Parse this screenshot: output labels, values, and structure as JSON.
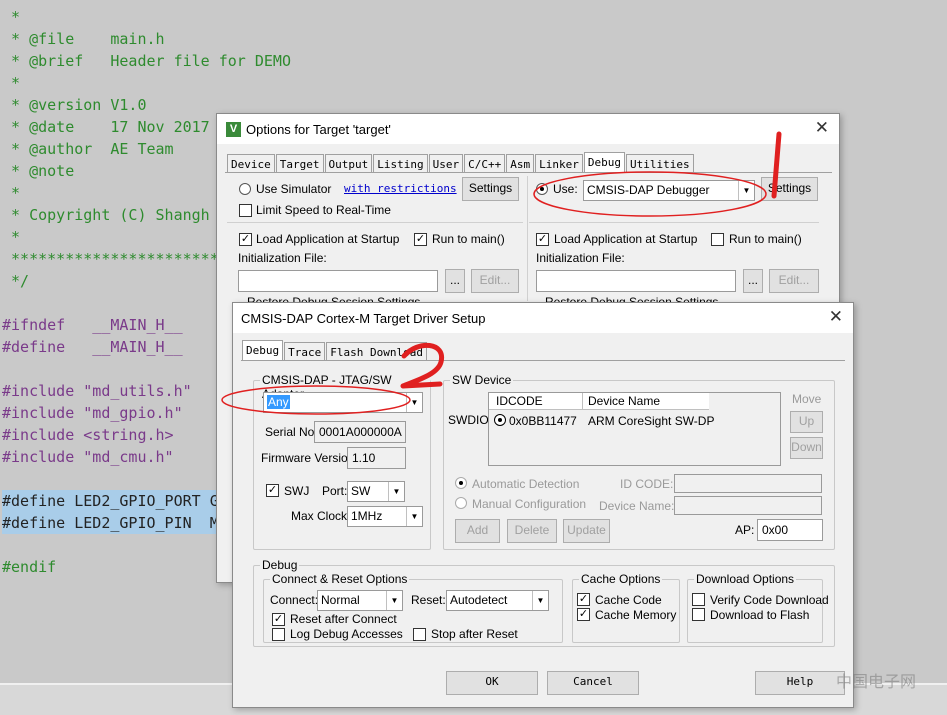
{
  "editor": {
    "lines": [
      {
        "text": " *",
        "color": "green",
        "hl": false
      },
      {
        "text": " * @file    main.h",
        "color": "green",
        "hl": false
      },
      {
        "text": " * @brief   Header file for DEMO",
        "color": "green",
        "hl": false
      },
      {
        "text": " *",
        "color": "green",
        "hl": false
      },
      {
        "text": " * @version V1.0",
        "color": "green",
        "hl": false
      },
      {
        "text": " * @date    17 Nov 2017",
        "color": "green",
        "hl": false
      },
      {
        "text": " * @author  AE Team",
        "color": "green",
        "hl": false
      },
      {
        "text": " * @note",
        "color": "green",
        "hl": false
      },
      {
        "text": " *",
        "color": "green",
        "hl": false
      },
      {
        "text": " * Copyright (C) Shangh",
        "color": "green",
        "hl": false
      },
      {
        "text": " *",
        "color": "green",
        "hl": false
      },
      {
        "text": " *************************",
        "color": "green",
        "hl": false
      },
      {
        "text": " */",
        "color": "green",
        "hl": false
      },
      {
        "text": "",
        "color": "black",
        "hl": false
      },
      {
        "text": "#ifndef   __MAIN_H__",
        "color": "mix",
        "hl": false
      },
      {
        "text": "#define   __MAIN_H__",
        "color": "mix",
        "hl": false
      },
      {
        "text": "",
        "color": "black",
        "hl": false
      },
      {
        "text": "#include \"md_utils.h\"",
        "color": "purple",
        "hl": false
      },
      {
        "text": "#include \"md_gpio.h\"",
        "color": "purple",
        "hl": false
      },
      {
        "text": "#include <string.h>",
        "color": "purple",
        "hl": false
      },
      {
        "text": "#include \"md_cmu.h\"",
        "color": "purple",
        "hl": false
      },
      {
        "text": "",
        "color": "black",
        "hl": false
      },
      {
        "text": "#define LED2_GPIO_PORT G",
        "color": "black",
        "hl": true
      },
      {
        "text": "#define LED2_GPIO_PIN  M",
        "color": "black",
        "hl": true
      },
      {
        "text": "",
        "color": "black",
        "hl": false
      },
      {
        "text": "#endif",
        "color": "green",
        "hl": false
      }
    ]
  },
  "options_dialog": {
    "title": "Options for Target 'target'",
    "tabs": [
      "Device",
      "Target",
      "Output",
      "Listing",
      "User",
      "C/C++",
      "Asm",
      "Linker",
      "Debug",
      "Utilities"
    ],
    "active_tab": "Debug",
    "left": {
      "use_simulator": "Use Simulator",
      "with_restrictions": "with restrictions",
      "settings": "Settings",
      "limit_speed": "Limit Speed to Real-Time",
      "load_app": "Load Application at Startup",
      "run_to_main": "Run to main()",
      "init_file": "Initialization File:",
      "browse": "...",
      "edit": "Edit...",
      "restore_partial": "Restore Debug Session Settings"
    },
    "right": {
      "use": "Use:",
      "debugger": "CMSIS-DAP Debugger",
      "settings": "Settings",
      "load_app": "Load Application at Startup",
      "run_to_main": "Run to main()",
      "init_file": "Initialization File:",
      "browse": "...",
      "edit": "Edit...",
      "restore_partial": "Restore Debug Session Settings"
    }
  },
  "driver_dialog": {
    "title": "CMSIS-DAP Cortex-M Target Driver Setup",
    "tabs": [
      "Debug",
      "Trace",
      "Flash Download"
    ],
    "active_tab": "Debug",
    "adapter_group": "CMSIS-DAP - JTAG/SW Adapter",
    "adapter_value": "Any",
    "serial_label": "Serial No:",
    "serial_value": "0001A000000A",
    "firmware_label": "Firmware Version:",
    "firmware_value": "1.10",
    "swj_label": "SWJ",
    "port_label": "Port:",
    "port_value": "SW",
    "maxclock_label": "Max Clock:",
    "maxclock_value": "1MHz",
    "sw_device_group": "SW Device",
    "swdio_label": "SWDIO",
    "col_idcode": "IDCODE",
    "col_device_name": "Device Name",
    "device_idcode": "0x0BB11477",
    "device_name": "ARM CoreSight SW-DP",
    "move": "Move",
    "up": "Up",
    "down": "Down",
    "auto_detect": "Automatic Detection",
    "manual_config": "Manual Configuration",
    "id_code_label": "ID CODE:",
    "device_name_label": "Device Name:",
    "add": "Add",
    "delete": "Delete",
    "update": "Update",
    "ap_label": "AP:",
    "ap_value": "0x00",
    "debug_group": "Debug",
    "connect_reset_group": "Connect & Reset Options",
    "connect_label": "Connect:",
    "connect_value": "Normal",
    "reset_label": "Reset:",
    "reset_value": "Autodetect",
    "reset_after_connect": "Reset after Connect",
    "log_debug": "Log Debug Accesses",
    "stop_after_reset": "Stop after Reset",
    "cache_group": "Cache Options",
    "cache_code": "Cache Code",
    "cache_memory": "Cache Memory",
    "download_group": "Download Options",
    "verify_code": "Verify Code Download",
    "download_flash": "Download to Flash",
    "ok": "OK",
    "cancel": "Cancel",
    "help": "Help"
  },
  "annotations": {
    "mark1": "1",
    "mark2": "2",
    "color": "#e02020"
  },
  "watermark": "中国电子网"
}
